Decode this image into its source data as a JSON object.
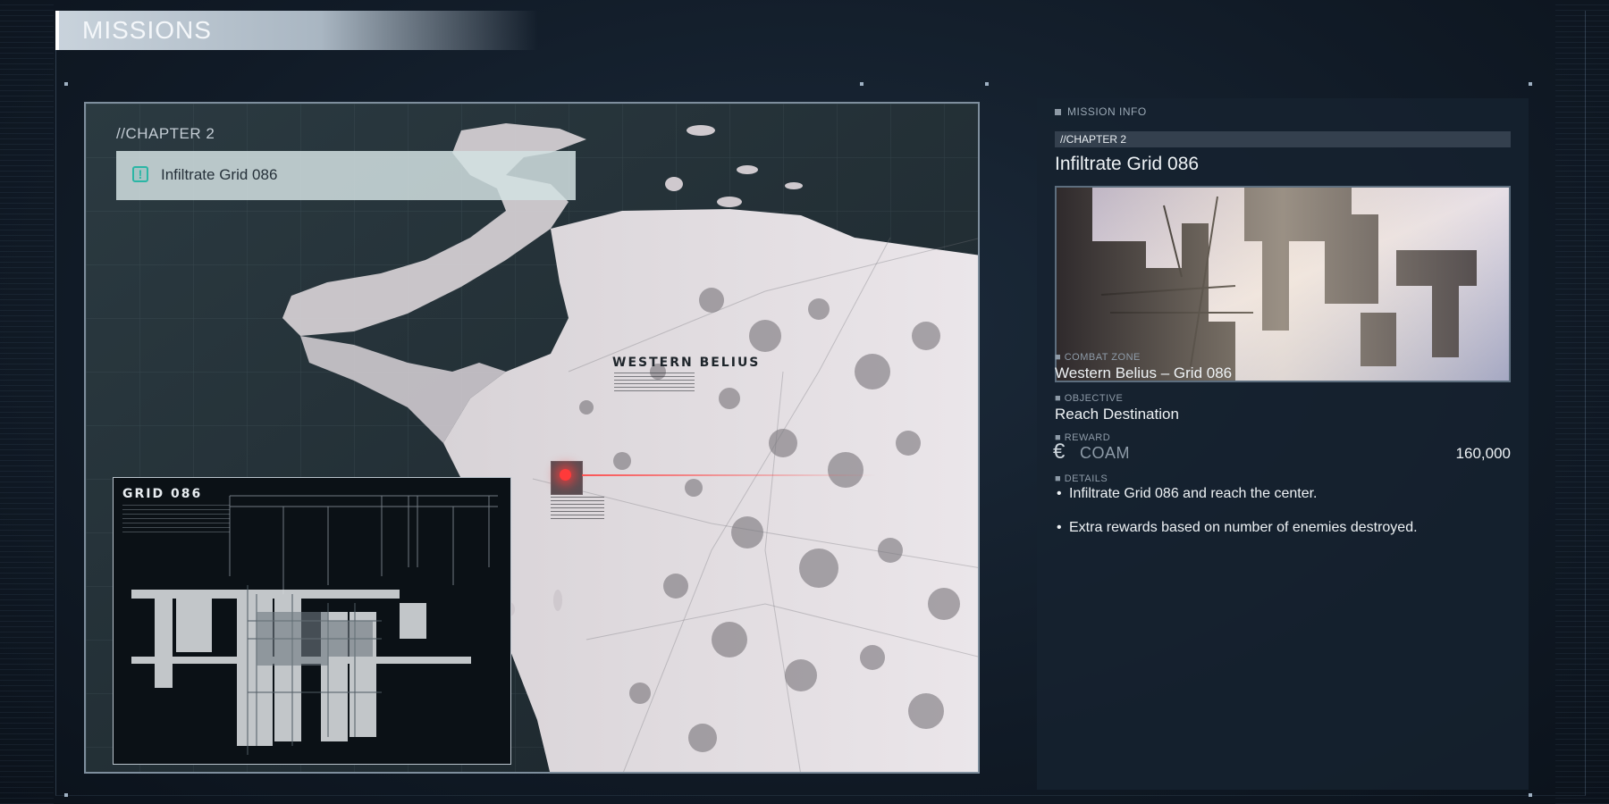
{
  "header": {
    "title": "MISSIONS"
  },
  "map": {
    "chapter": "//CHAPTER 2",
    "mission_name": "Infiltrate Grid 086",
    "region_label": "WESTERN BELIUS",
    "inset_title": "GRID 086"
  },
  "info": {
    "header": "MISSION INFO",
    "chapter": "//CHAPTER 2",
    "title": "Infiltrate Grid 086",
    "combat_zone_label": "COMBAT ZONE",
    "combat_zone": "Western Belius – Grid 086",
    "objective_label": "OBJECTIVE",
    "objective": "Reach Destination",
    "reward_label": "REWARD",
    "reward_currency_symbol": "€",
    "reward_currency": "COAM",
    "reward_amount": "160,000",
    "details_label": "DETAILS",
    "details": [
      "Infiltrate Grid 086 and reach the center.",
      "Extra rewards based on number of enemies destroyed."
    ]
  },
  "colors": {
    "accent_teal": "#2bb6a5",
    "target_red": "#ff3a3a",
    "panel_bg": "#162230"
  },
  "icons": [
    "alert-icon",
    "coam-currency-icon",
    "target-marker-icon"
  ]
}
